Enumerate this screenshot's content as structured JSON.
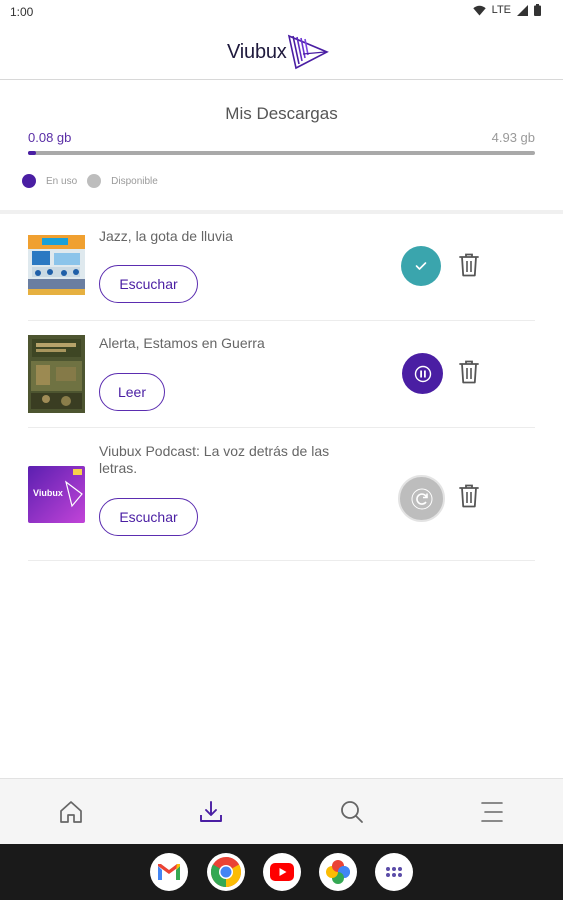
{
  "status_bar": {
    "time": "1:00",
    "network": "LTE"
  },
  "header": {
    "brand": "Viubux"
  },
  "storage": {
    "title": "Mis Descargas",
    "used": "0.08 gb",
    "available": "4.93 gb",
    "used_fraction": 0.016,
    "legend_used": "En uso",
    "legend_available": "Disponible",
    "colors": {
      "used": "#4a1ea3",
      "available": "#a9a9a9"
    }
  },
  "downloads": [
    {
      "title": "Jazz, la gota de lluvia",
      "action": "Escuchar",
      "status": "completed",
      "status_icon": "check-icon"
    },
    {
      "title": "Alerta, Estamos en Guerra",
      "action": "Leer",
      "status": "paused",
      "status_icon": "pause-icon"
    },
    {
      "title": "Viubux Podcast: La voz detrás de las letras.",
      "action": "Escuchar",
      "status": "pending",
      "status_icon": "refresh-icon",
      "cover_text": "Viubux"
    }
  ],
  "colors": {
    "accent": "#4a1ea3",
    "completed": "#3aa5ad",
    "pending": "#bdbdbd"
  },
  "bottom_nav": [
    {
      "icon": "home-icon"
    },
    {
      "icon": "download-icon",
      "active": true
    },
    {
      "icon": "search-icon"
    },
    {
      "icon": "menu-icon"
    }
  ],
  "dock_apps": [
    "gmail-icon",
    "chrome-icon",
    "youtube-icon",
    "photos-icon",
    "apps-icon"
  ]
}
